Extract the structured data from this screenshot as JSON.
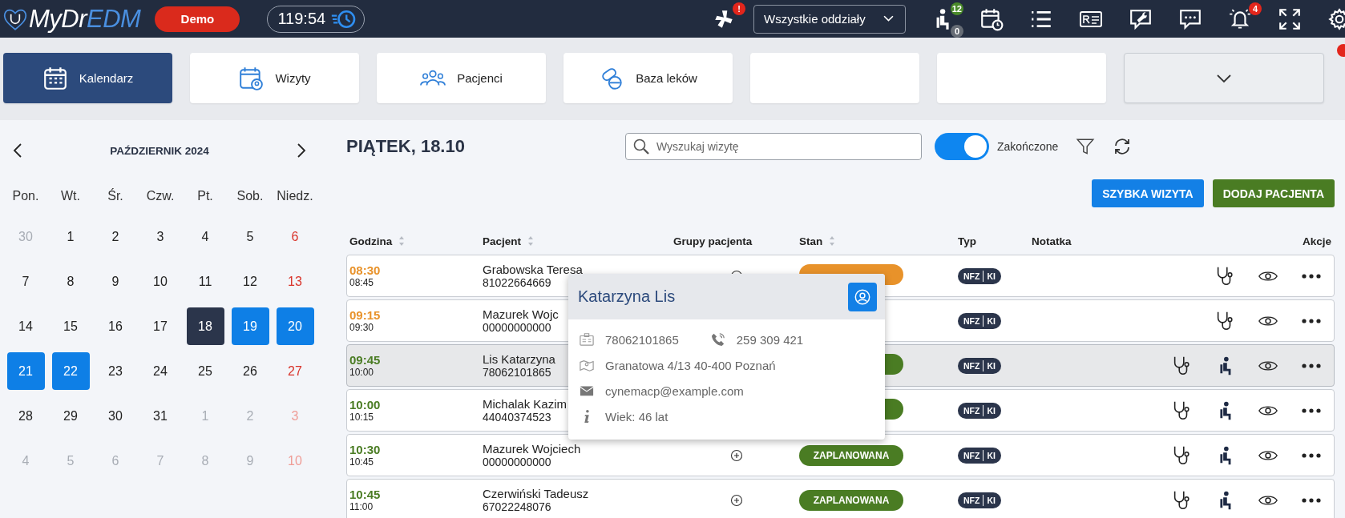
{
  "topbar": {
    "logo": {
      "primary": "MyDr",
      "accent": "EDM"
    },
    "env_button": "Demo",
    "timer": "119:54",
    "alert_badge": "!",
    "department": "Wszystkie oddziały",
    "waiting": {
      "count": "12",
      "second": "0"
    },
    "bell_badge": "4"
  },
  "tabs": [
    {
      "kind": "tab",
      "label": "Kalendarz",
      "selected": true
    },
    {
      "kind": "tab",
      "label": "Wizyty",
      "selected": false
    },
    {
      "kind": "tab",
      "label": "Pacjenci",
      "selected": false
    },
    {
      "kind": "tab",
      "label": "Baza leków",
      "selected": false
    },
    {
      "kind": "blank",
      "selected": false
    },
    {
      "kind": "blank",
      "selected": false
    },
    {
      "kind": "more",
      "selected": false
    }
  ],
  "calendar": {
    "title": "PAŹDZIERNIK 2024",
    "weekdays": [
      "Pon.",
      "Wt.",
      "Śr.",
      "Czw.",
      "Pt.",
      "Sob.",
      "Niedz."
    ],
    "weeks": [
      [
        {
          "label": "30",
          "outside": true,
          "selected": false,
          "in_range": false
        },
        {
          "label": "1",
          "outside": false,
          "selected": false,
          "in_range": false
        },
        {
          "label": "2",
          "outside": false,
          "selected": false,
          "in_range": false
        },
        {
          "label": "3",
          "outside": false,
          "selected": false,
          "in_range": false
        },
        {
          "label": "4",
          "outside": false,
          "selected": false,
          "in_range": false
        },
        {
          "label": "5",
          "outside": false,
          "selected": false,
          "in_range": false
        },
        {
          "label": "6",
          "outside": false,
          "selected": false,
          "in_range": false
        }
      ],
      [
        {
          "label": "7",
          "outside": false,
          "selected": false,
          "in_range": false
        },
        {
          "label": "8",
          "outside": false,
          "selected": false,
          "in_range": false
        },
        {
          "label": "9",
          "outside": false,
          "selected": false,
          "in_range": false
        },
        {
          "label": "10",
          "outside": false,
          "selected": false,
          "in_range": false
        },
        {
          "label": "11",
          "outside": false,
          "selected": false,
          "in_range": false
        },
        {
          "label": "12",
          "outside": false,
          "selected": false,
          "in_range": false
        },
        {
          "label": "13",
          "outside": false,
          "selected": false,
          "in_range": false
        }
      ],
      [
        {
          "label": "14",
          "outside": false,
          "selected": false,
          "in_range": false
        },
        {
          "label": "15",
          "outside": false,
          "selected": false,
          "in_range": false
        },
        {
          "label": "16",
          "outside": false,
          "selected": false,
          "in_range": false
        },
        {
          "label": "17",
          "outside": false,
          "selected": false,
          "in_range": false
        },
        {
          "label": "18",
          "outside": false,
          "selected": true,
          "in_range": false
        },
        {
          "label": "19",
          "outside": false,
          "selected": false,
          "in_range": true
        },
        {
          "label": "20",
          "outside": false,
          "selected": false,
          "in_range": true
        }
      ],
      [
        {
          "label": "21",
          "outside": false,
          "selected": false,
          "in_range": true
        },
        {
          "label": "22",
          "outside": false,
          "selected": false,
          "in_range": true
        },
        {
          "label": "23",
          "outside": false,
          "selected": false,
          "in_range": false
        },
        {
          "label": "24",
          "outside": false,
          "selected": false,
          "in_range": false
        },
        {
          "label": "25",
          "outside": false,
          "selected": false,
          "in_range": false
        },
        {
          "label": "26",
          "outside": false,
          "selected": false,
          "in_range": false
        },
        {
          "label": "27",
          "outside": false,
          "selected": false,
          "in_range": false
        }
      ],
      [
        {
          "label": "28",
          "outside": false,
          "selected": false,
          "in_range": false
        },
        {
          "label": "29",
          "outside": false,
          "selected": false,
          "in_range": false
        },
        {
          "label": "30",
          "outside": false,
          "selected": false,
          "in_range": false
        },
        {
          "label": "31",
          "outside": false,
          "selected": false,
          "in_range": false
        },
        {
          "label": "1",
          "outside": true,
          "selected": false,
          "in_range": false
        },
        {
          "label": "2",
          "outside": true,
          "selected": false,
          "in_range": false
        },
        {
          "label": "3",
          "outside": true,
          "selected": false,
          "in_range": false
        }
      ],
      [
        {
          "label": "4",
          "outside": true,
          "selected": false,
          "in_range": false
        },
        {
          "label": "5",
          "outside": true,
          "selected": false,
          "in_range": false
        },
        {
          "label": "6",
          "outside": true,
          "selected": false,
          "in_range": false
        },
        {
          "label": "7",
          "outside": true,
          "selected": false,
          "in_range": false
        },
        {
          "label": "8",
          "outside": true,
          "selected": false,
          "in_range": false
        },
        {
          "label": "9",
          "outside": true,
          "selected": false,
          "in_range": false
        },
        {
          "label": "10",
          "outside": true,
          "selected": false,
          "in_range": false
        }
      ]
    ]
  },
  "day_title": "PIĄTEK, 18.10",
  "search": {
    "placeholder": "Wyszukaj wizytę"
  },
  "completed_toggle": {
    "label": "Zakończone",
    "on": true
  },
  "buttons": [
    {
      "kind": "primary",
      "label": "SZYBKA WIZYTA"
    },
    {
      "kind": "success",
      "label": "DODAJ PACJENTA"
    }
  ],
  "table": {
    "columns": [
      {
        "label": "Godzina",
        "sortable": true
      },
      {
        "label": "Pacjent",
        "sortable": true
      },
      {
        "label": "Grupy pacjenta",
        "sortable": false
      },
      {
        "label": "Stan",
        "sortable": true
      },
      {
        "label": "Typ",
        "sortable": false
      },
      {
        "label": "Notatka",
        "sortable": false
      },
      {
        "label": "Akcje",
        "sortable": false
      }
    ],
    "rows": [
      {
        "start": "08:30",
        "end": "08:45",
        "color": "#e8922a",
        "patient": "Grabowska Teresa",
        "pesel": "81022664669",
        "add_group": true,
        "status": {
          "kind": "pending"
        },
        "type": [
          "NFZ",
          "KI"
        ],
        "waiting": false,
        "selected": false
      },
      {
        "start": "09:15",
        "end": "09:30",
        "color": "#e8922a",
        "patient": "Mazurek Wojc",
        "pesel": "00000000000",
        "type": [
          "NFZ",
          "KI"
        ],
        "waiting": false,
        "selected": false
      },
      {
        "start": "09:45",
        "end": "10:00",
        "color": "#4a7c23",
        "patient": "Lis Katarzyna",
        "pesel": "78062101865",
        "status": {
          "kind": "scheduled"
        },
        "type": [
          "NFZ",
          "KI"
        ],
        "waiting": true,
        "selected": true
      },
      {
        "start": "10:00",
        "end": "10:15",
        "color": "#4a7c23",
        "patient": "Michalak Kazim",
        "pesel": "44040374523",
        "status": {
          "kind": "scheduled"
        },
        "type": [
          "NFZ",
          "KI"
        ],
        "waiting": true,
        "selected": false
      },
      {
        "start": "10:30",
        "end": "10:45",
        "color": "#4a7c23",
        "patient": "Mazurek Wojciech",
        "pesel": "00000000000",
        "add_group": true,
        "status": {
          "kind": "scheduled",
          "label": "ZAPLANOWANA"
        },
        "type": [
          "NFZ",
          "KI"
        ],
        "waiting": true,
        "selected": false
      },
      {
        "start": "10:45",
        "end": "11:00",
        "color": "#4a7c23",
        "patient": "Czerwiński Tadeusz",
        "pesel": "67022248076",
        "add_group": true,
        "status": {
          "kind": "scheduled",
          "label": "ZAPLANOWANA"
        },
        "type": [
          "NFZ",
          "KI"
        ],
        "waiting": true,
        "selected": false
      }
    ]
  },
  "popup": {
    "name": "Katarzyna Lis",
    "pesel": "78062101865",
    "phone": "259 309 421",
    "address": "Granatowa 4/13 40-400 Poznań",
    "email": "cynemacp@example.com",
    "age": "Wiek: 46 lat"
  }
}
